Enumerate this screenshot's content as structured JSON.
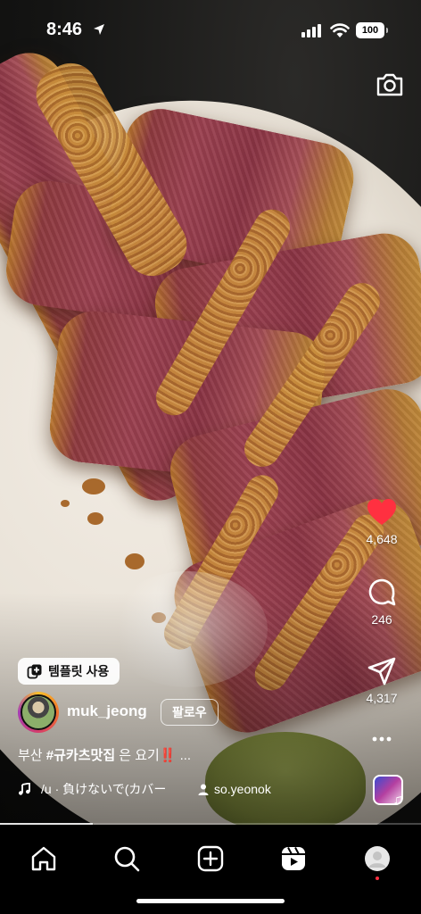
{
  "status_bar": {
    "time": "8:46",
    "battery": "100",
    "icons": [
      "location-arrow-icon",
      "cellular-signal-icon",
      "wifi-icon",
      "battery-icon"
    ]
  },
  "top": {
    "camera_icon": "camera-icon"
  },
  "actions": {
    "likes": "4,648",
    "comments": "246",
    "shares": "4,317",
    "like_color": "#ff3040",
    "icons": [
      "heart-icon",
      "comment-icon",
      "send-icon",
      "more-icon"
    ]
  },
  "post": {
    "template_label": "템플릿 사용",
    "username": "muk_jeong",
    "follow_label": "팔로우",
    "caption": {
      "prefix": "부산 ",
      "hashtag": "#규카츠맛집",
      "rest": " 은 요기",
      "emoji": "‼️",
      "more": "..."
    },
    "music": {
      "song": "/u · 負けないで(カバー",
      "collaborator": "so.yeonok"
    },
    "progress": 0.22
  },
  "nav": {
    "items": [
      "home",
      "search",
      "create",
      "reels",
      "profile"
    ]
  }
}
